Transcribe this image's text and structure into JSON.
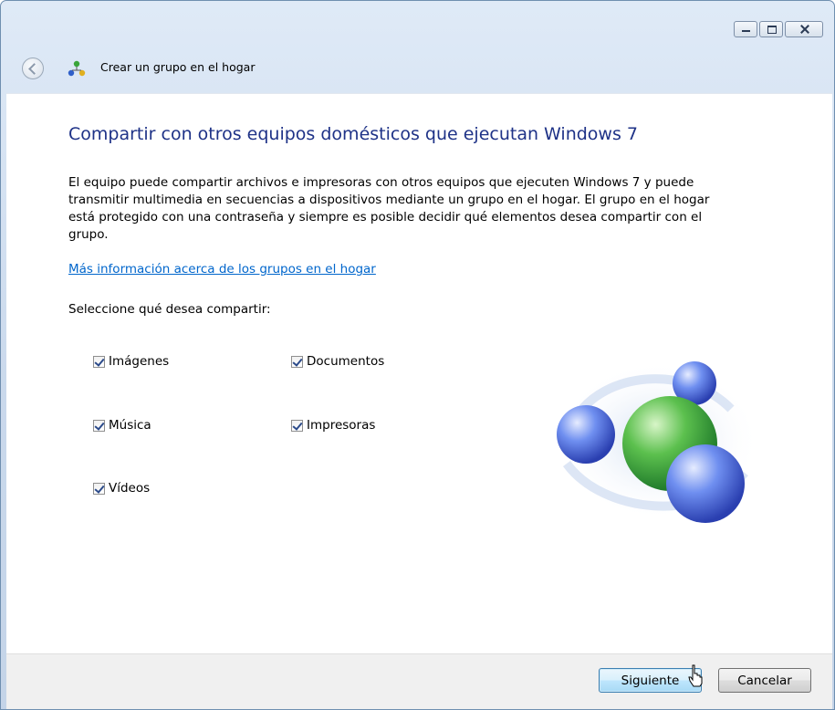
{
  "window": {
    "title": "Crear un grupo en el hogar"
  },
  "content": {
    "heading": "Compartir con otros equipos domésticos que ejecutan Windows 7",
    "description_lines": [
      "El equipo puede compartir archivos e impresoras con otros equipos que ejecuten Windows 7 y puede",
      "transmitir multimedia en secuencias a dispositivos mediante un grupo en el hogar. El grupo en el hogar",
      "está protegido con una contraseña y siempre es posible decidir qué elementos desea compartir con el",
      "grupo."
    ],
    "link": "Más información acerca de los grupos en el hogar",
    "select_label": "Seleccione qué desea compartir:",
    "share_items": [
      {
        "label": "Imágenes",
        "checked": true
      },
      {
        "label": "Documentos",
        "checked": true
      },
      {
        "label": "Música",
        "checked": true
      },
      {
        "label": "Impresoras",
        "checked": true
      },
      {
        "label": "Vídeos",
        "checked": true
      }
    ]
  },
  "footer": {
    "next_label": "Siguiente",
    "cancel_label": "Cancelar"
  },
  "icons": {
    "back": "back-arrow-icon",
    "homegroup": "homegroup-icon",
    "illustration": "homegroup-spheres-illustration"
  },
  "colors": {
    "heading": "#1e3287",
    "link": "#0066cc",
    "frame": "#cad9ec"
  }
}
